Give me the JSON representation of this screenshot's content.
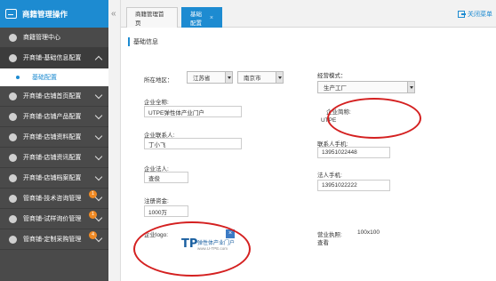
{
  "sidebar": {
    "title": "商籍管理操作",
    "items": [
      {
        "label": "商籍管理中心",
        "chevron": false
      },
      {
        "label": "开商铺-基础信息配置",
        "chevron": "up"
      },
      {
        "label": "开商铺-店铺首页配置",
        "chevron": "down"
      },
      {
        "label": "开商铺-店铺产品配置",
        "chevron": "down"
      },
      {
        "label": "开商铺-店铺资料配置",
        "chevron": "down"
      },
      {
        "label": "开商铺-店铺资讯配置",
        "chevron": "down"
      },
      {
        "label": "开商铺-店铺档案配置",
        "chevron": "down"
      },
      {
        "label": "管商铺-技术咨询管理",
        "chevron": "down",
        "badge": "1"
      },
      {
        "label": "管商铺-试样询价管理",
        "chevron": "down",
        "badge": "1"
      },
      {
        "label": "管商铺-定制采购管理",
        "chevron": "down",
        "badge": "4"
      }
    ],
    "sub_item": "基础配置"
  },
  "topbar": {
    "collapse_glyph": "«",
    "tabs": [
      {
        "label": "商籍管理首页",
        "active": false
      },
      {
        "label": "基础配置",
        "active": true,
        "close": "×"
      }
    ],
    "close_all": "关闭菜单"
  },
  "main": {
    "section_title": "基础信息",
    "region_label": "所在地区：",
    "province": "江苏省",
    "city": "南京市",
    "business_mode_label": "经营模式：",
    "business_mode_value": "生产工厂",
    "company_name_label": "企业全称:",
    "company_name_value": "UTPE弹性体产业门户",
    "company_short_label": "企业简称:",
    "company_short_value": "UTPE",
    "contact_label": "企业联系人:",
    "contact_value": "丁小飞",
    "contact_phone_label": "联系人手机:",
    "contact_phone_value": "13951022448",
    "legal_label": "企业法人:",
    "legal_value": "查俊",
    "legal_phone_label": "法人手机:",
    "legal_phone_value": "13951022222",
    "capital_label": "注册资金:",
    "capital_value": "1000万",
    "logo_label": "企业logo:",
    "logo_text_cn": "弹性体产业门户",
    "logo_text_url": "www.U-TPE.com",
    "logo_text_mark": "TP",
    "license_label": "营业执照:",
    "license_size": "100x100",
    "license_view": "查看"
  },
  "colors": {
    "accent": "#1d8bd1",
    "sidebar_bg": "#4a4a4a",
    "annotation": "#d42020",
    "badge": "#f08a24"
  }
}
